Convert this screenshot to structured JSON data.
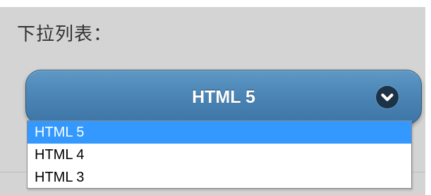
{
  "form": {
    "label": "下拉列表：",
    "select": {
      "selected_value": "HTML 5",
      "options": [
        {
          "label": "HTML 5",
          "highlighted": true
        },
        {
          "label": "HTML 4",
          "highlighted": false
        },
        {
          "label": "HTML 3",
          "highlighted": false
        }
      ],
      "icon": "chevron-down-circle-icon"
    }
  },
  "colors": {
    "panel_background": "#d4d4d4",
    "button_gradient_top": "#5f98c5",
    "button_gradient_bottom": "#3d75a5",
    "button_text": "#ffffff",
    "chevron_circle": "#1c3246",
    "option_highlight": "#3399ff",
    "option_text": "#000000"
  }
}
